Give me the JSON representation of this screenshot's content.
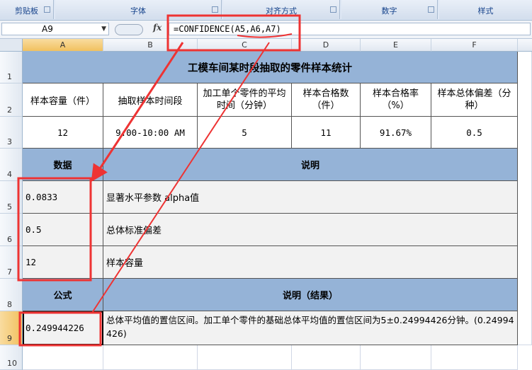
{
  "ribbon": {
    "groups": [
      "剪贴板",
      "字体",
      "对齐方式",
      "数字",
      "样式"
    ]
  },
  "formula_bar": {
    "name_box": "A9",
    "fx_label": "fx",
    "formula": "=CONFIDENCE(A5,A6,A7)"
  },
  "columns": [
    "A",
    "B",
    "C",
    "D",
    "E",
    "F"
  ],
  "rows": [
    "1",
    "2",
    "3",
    "4",
    "5",
    "6",
    "7",
    "8",
    "9",
    "10"
  ],
  "sheet": {
    "title": "工模车间某时段抽取的零件样本统计",
    "headers": [
      "样本容量（件）",
      "抽取样本时间段",
      "加工单个零件的平均时间（分钟）",
      "样本合格数（件）",
      "样本合格率（%）",
      "样本总体偏差（分种）"
    ],
    "values": [
      "12",
      "9:00-10:00 AM",
      "5",
      "11",
      "91.67%",
      "0.5"
    ],
    "data_header": "数据",
    "desc_header": "说明",
    "data_rows": [
      {
        "value": "0.0833",
        "desc": "显著水平参数 alpha值"
      },
      {
        "value": "0.5",
        "desc": "总体标准偏差"
      },
      {
        "value": "12",
        "desc": "样本容量"
      }
    ],
    "formula_header": "公式",
    "result_header": "说明（结果）",
    "result_value": "0.249944226",
    "result_desc": "总体平均值的置信区间。加工单个零件的基础总体平均值的置信区间为5±0.24994426分钟。(0.24994426)"
  },
  "colors": {
    "header_fill": "#95b3d7",
    "annotation_red": "#ee3333"
  }
}
